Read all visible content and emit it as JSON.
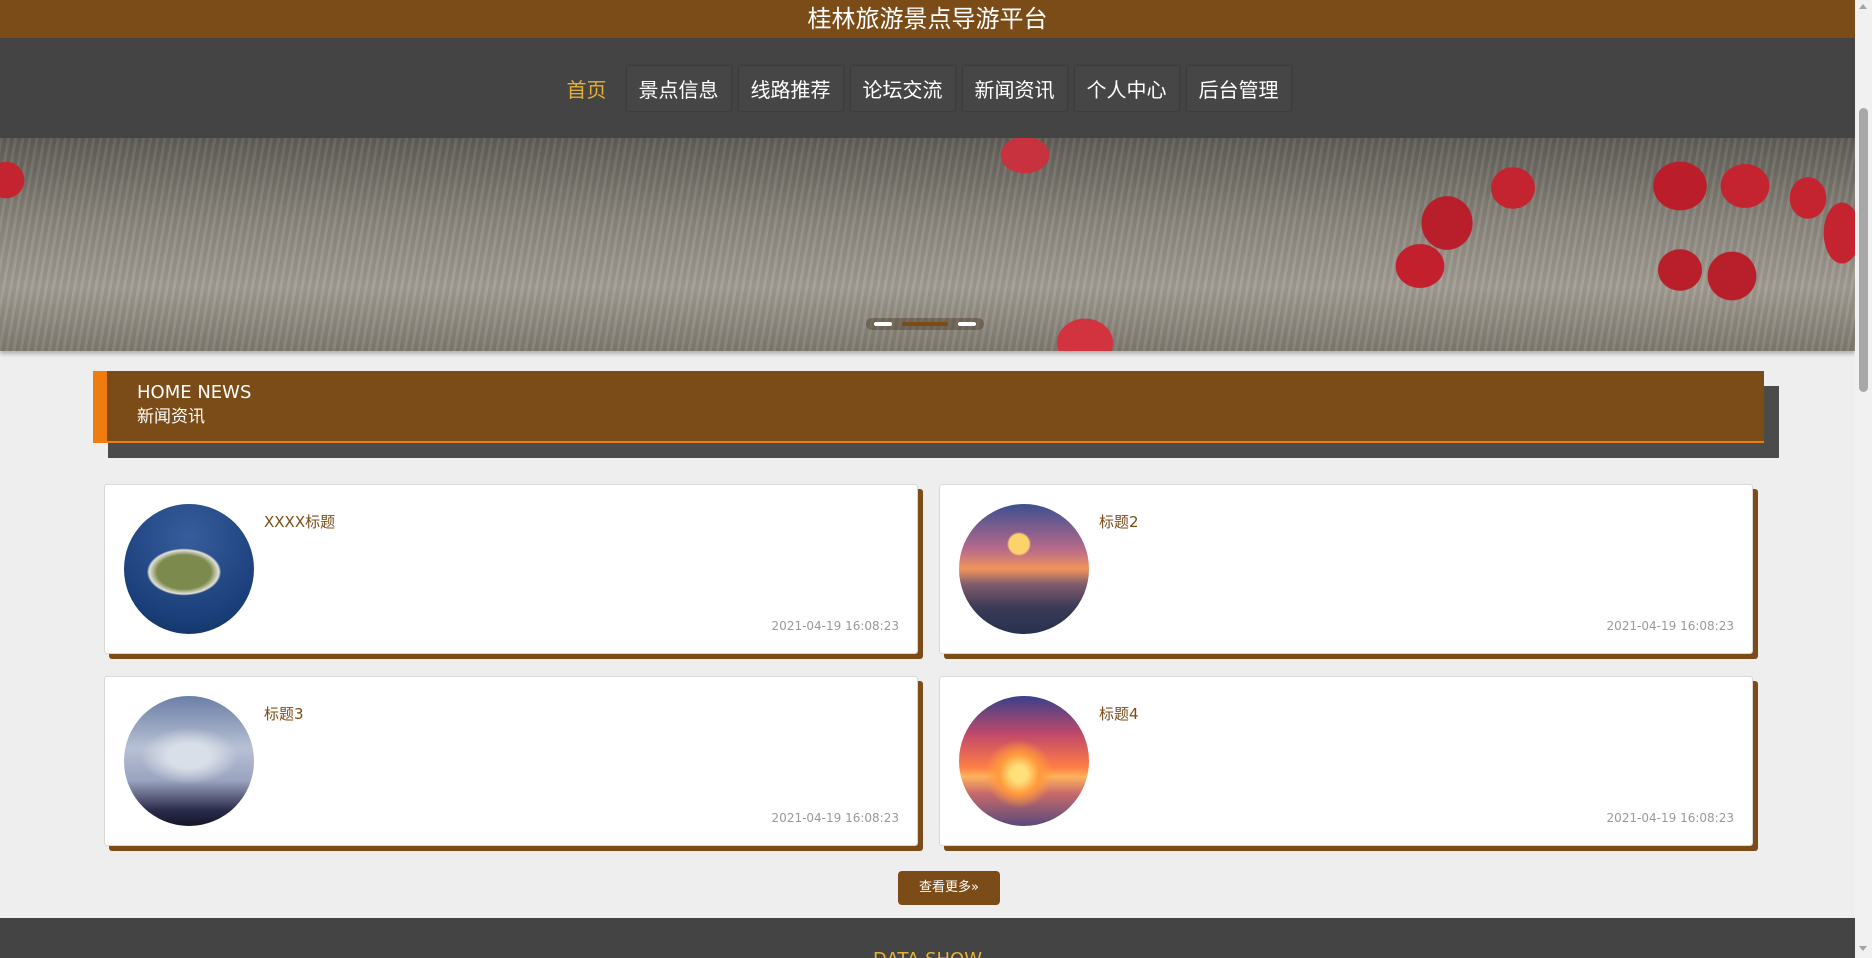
{
  "site": {
    "title": "桂林旅游景点导游平台"
  },
  "nav": {
    "items": [
      {
        "label": "首页",
        "active": true
      },
      {
        "label": "景点信息",
        "active": false
      },
      {
        "label": "线路推荐",
        "active": false
      },
      {
        "label": "论坛交流",
        "active": false
      },
      {
        "label": "新闻资讯",
        "active": false
      },
      {
        "label": "个人中心",
        "active": false
      },
      {
        "label": "后台管理",
        "active": false
      }
    ]
  },
  "news_section": {
    "heading_en": "HOME NEWS",
    "heading_cn": "新闻资讯",
    "items": [
      {
        "title": "XXXX标题",
        "time": "2021-04-19 16:08:23"
      },
      {
        "title": "标题2",
        "time": "2021-04-19 16:08:23"
      },
      {
        "title": "标题3",
        "time": "2021-04-19 16:08:23"
      },
      {
        "title": "标题4",
        "time": "2021-04-19 16:08:23"
      }
    ],
    "more_label": "查看更多»"
  },
  "next_section": {
    "heading": "DATA SHOW"
  },
  "colors": {
    "brand": "#7b4c17",
    "accent": "#f07c10",
    "nav_bg": "#444444",
    "active_nav": "#e3b13a"
  }
}
